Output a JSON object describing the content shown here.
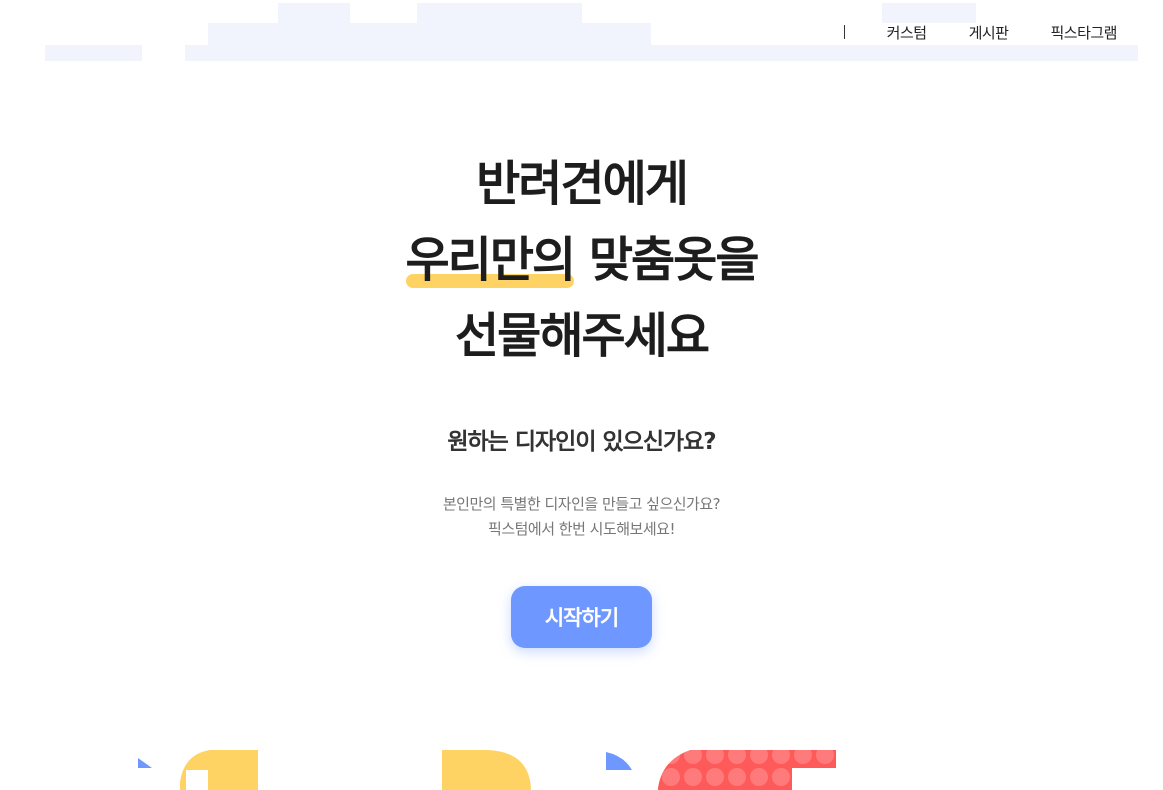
{
  "nav": {
    "items": [
      "커스텀",
      "게시판",
      "픽스타그램"
    ]
  },
  "hero": {
    "line1": "반려견에게",
    "line2_highlight": "우리만의",
    "line2_rest": " 맞춤옷을",
    "line3": "선물해주세요"
  },
  "subtitle": "원하는 디자인이 있으신가요?",
  "description": {
    "line1": "본인만의 특별한 디자인을 만들고 싶으신가요?",
    "line2": "픽스텀에서 한번 시도해보세요!"
  },
  "cta": {
    "label": "시작하기"
  },
  "colors": {
    "accent_blue": "#6e97ff",
    "highlight_yellow": "#ffd363",
    "coral": "#ff5a5a",
    "header_tint": "#f1f4fc"
  }
}
